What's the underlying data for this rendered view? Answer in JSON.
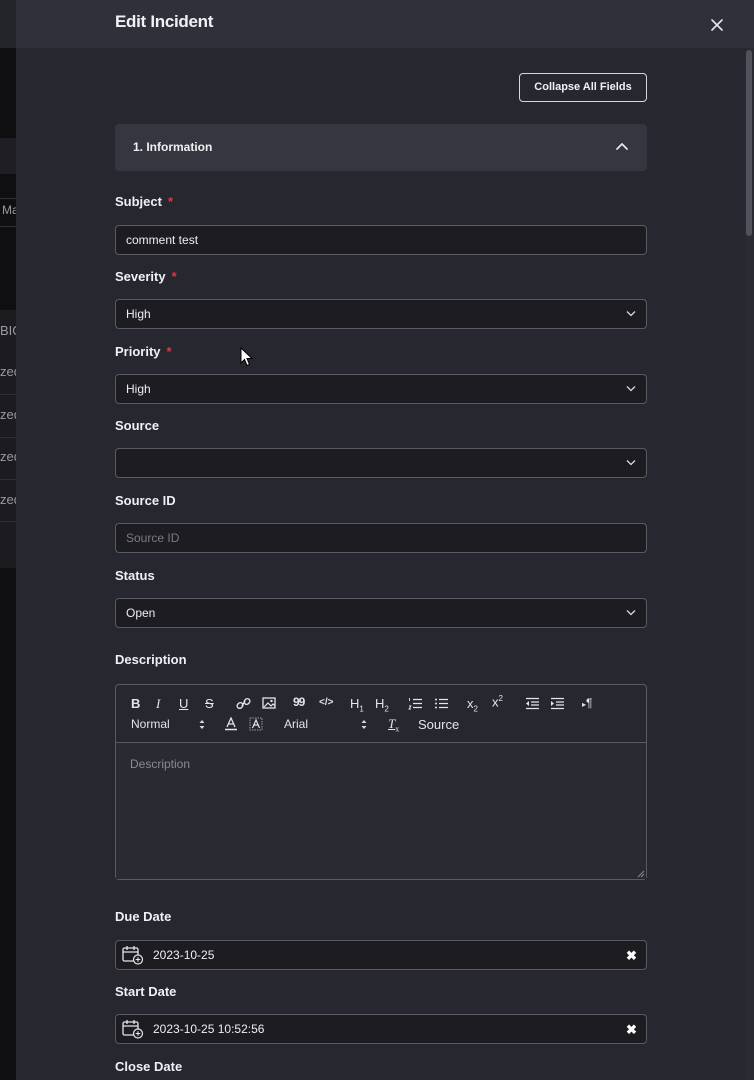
{
  "background": {
    "fragments": [
      "Ma",
      "BIG",
      "zed",
      "zed",
      "zed",
      "zed"
    ]
  },
  "drawer": {
    "title": "Edit Incident",
    "collapse_label": "Collapse All Fields"
  },
  "section": {
    "title": "1. Information"
  },
  "fields": {
    "subject": {
      "label": "Subject",
      "required": "*",
      "value": "comment test"
    },
    "severity": {
      "label": "Severity",
      "required": "*",
      "value": "High"
    },
    "priority": {
      "label": "Priority",
      "required": "*",
      "value": "High"
    },
    "source": {
      "label": "Source",
      "value": ""
    },
    "source_id": {
      "label": "Source ID",
      "placeholder": "Source ID"
    },
    "status": {
      "label": "Status",
      "value": "Open"
    },
    "description": {
      "label": "Description",
      "placeholder": "Description"
    },
    "due_date": {
      "label": "Due Date",
      "value": "2023-10-25"
    },
    "start_date": {
      "label": "Start Date",
      "value": "2023-10-25 10:52:56"
    },
    "close_date": {
      "label": "Close Date"
    }
  },
  "toolbar": {
    "bold": "B",
    "italic": "I",
    "underline": "U",
    "strike": "S",
    "blockquote": "99",
    "code": "</>",
    "h1": "H",
    "h1_sub": "1",
    "h2": "H",
    "h2_sub": "2",
    "subscript": "x",
    "subscript_sub": "2",
    "superscript": "x",
    "superscript_sup": "2",
    "pilcrow": "¶",
    "format": "Normal",
    "font": "Arial",
    "clear": "T",
    "clear_sub": "x",
    "source": "Source"
  },
  "colors": {
    "drawer_bg": "#27272f",
    "header_bg": "#30303a",
    "input_bg": "#1c1c21",
    "required": "#e0344a"
  }
}
